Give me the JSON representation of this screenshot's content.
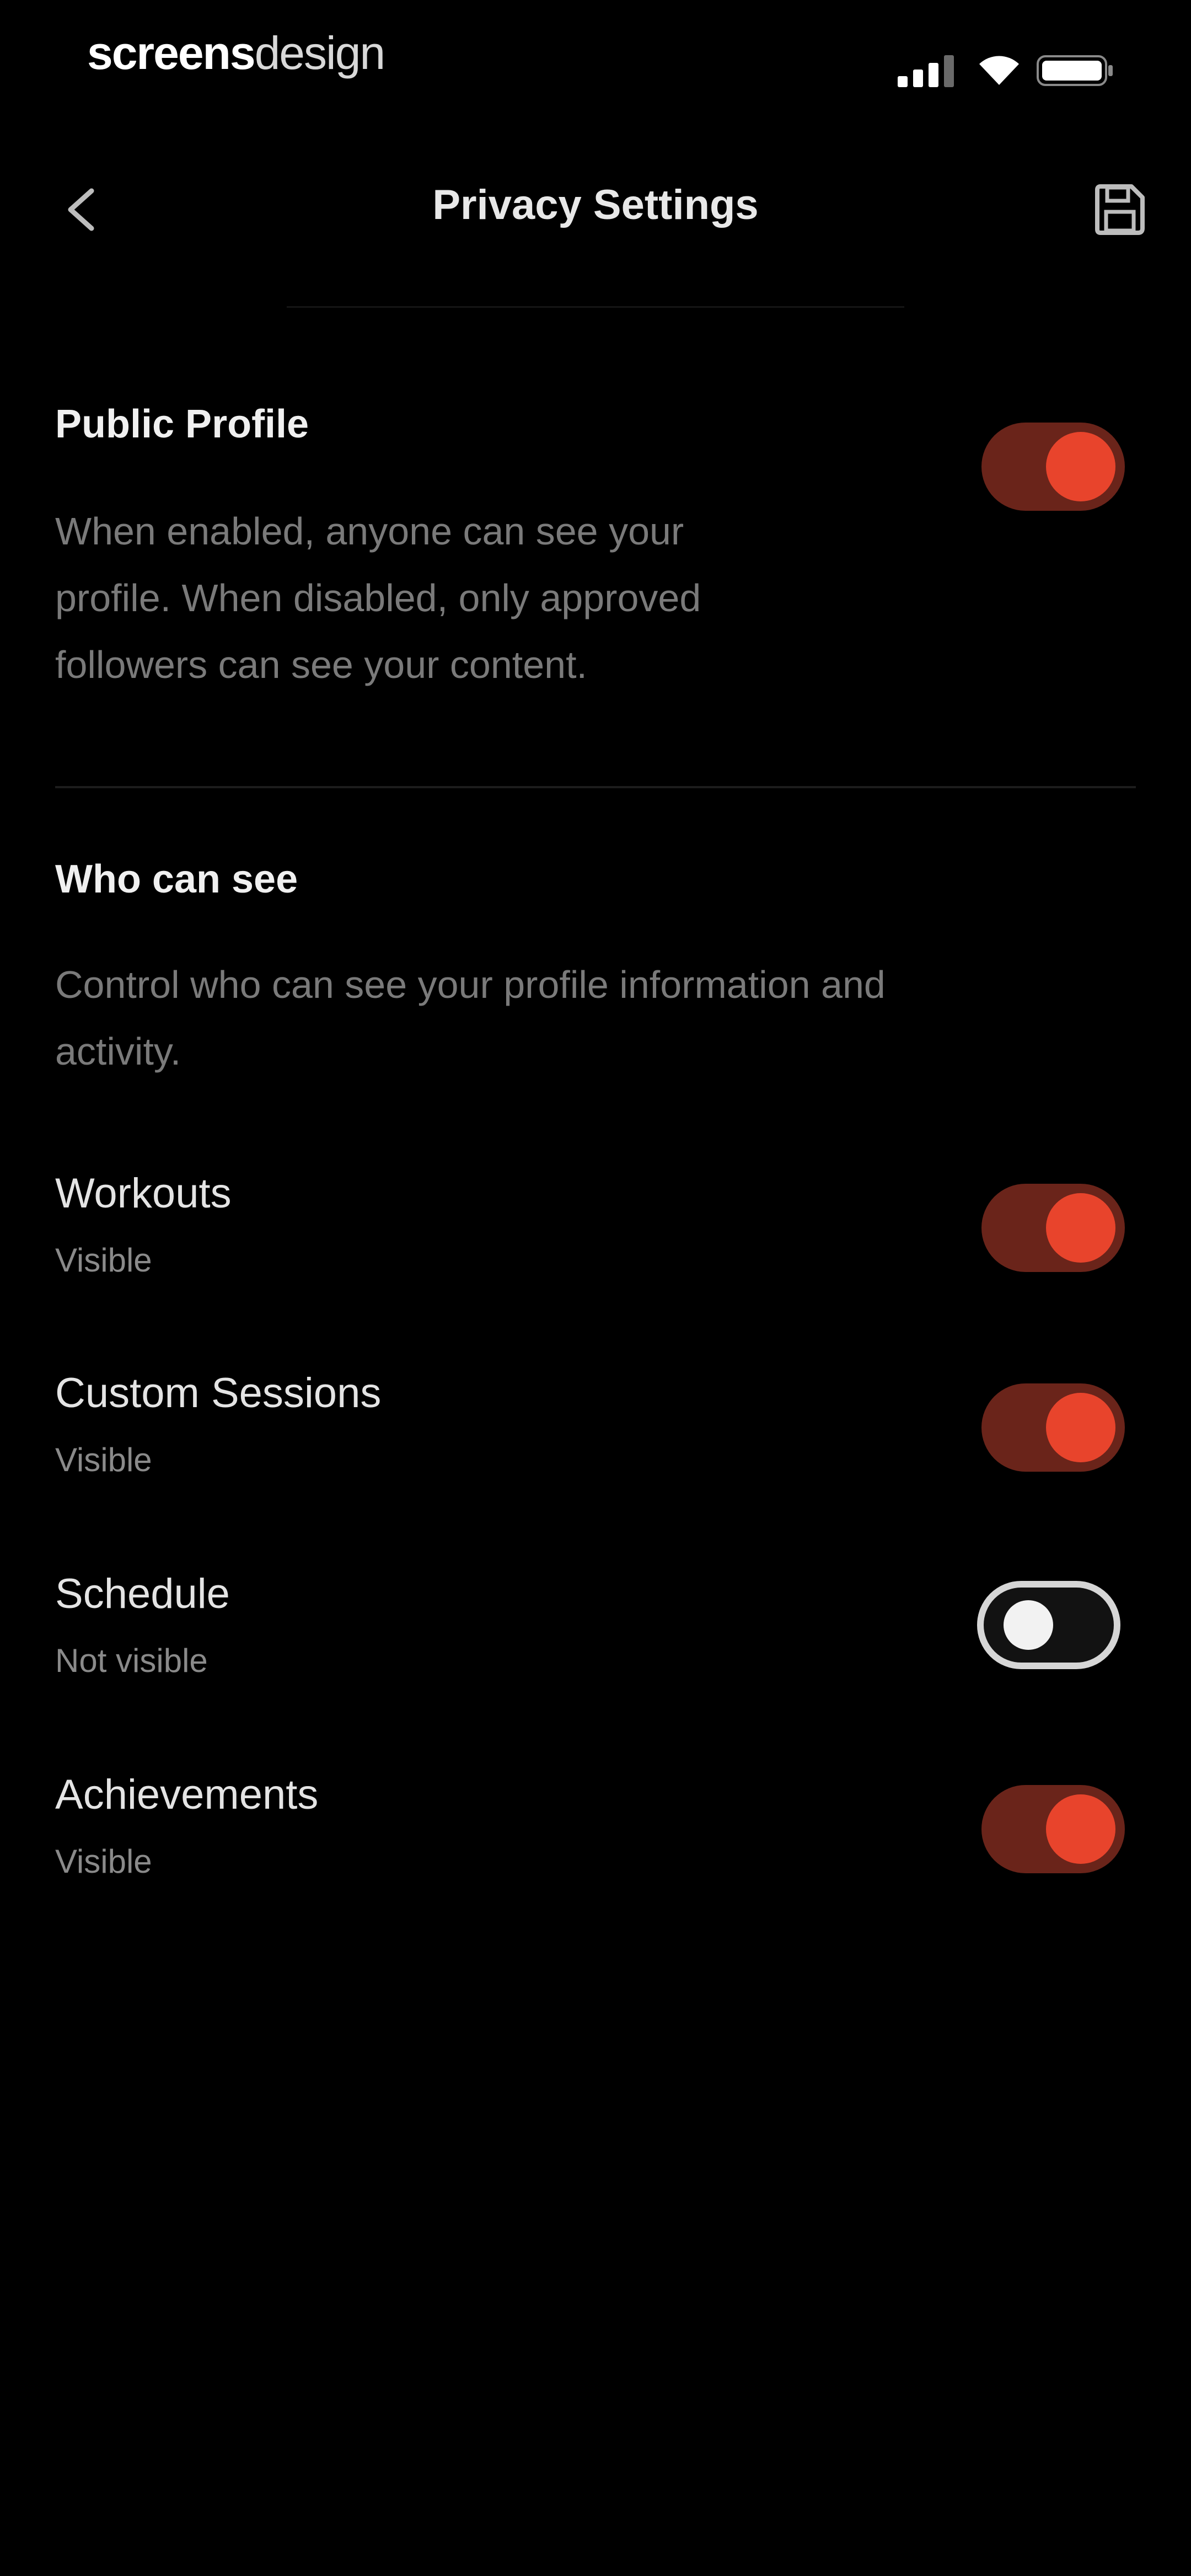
{
  "status_bar": {
    "brand_bold": "screens",
    "brand_light": "design"
  },
  "header": {
    "title": "Privacy Settings",
    "back_icon": "chevron-left-icon",
    "save_icon": "save-icon"
  },
  "public_profile": {
    "heading": "Public Profile",
    "description_lines": [
      "When enabled, anyone can see your",
      "profile. When disabled, only approved",
      "followers can see your content."
    ],
    "enabled": true
  },
  "who_can_see": {
    "heading": "Who can see",
    "description_lines": [
      "Control who can see your profile information and",
      "activity."
    ],
    "items": [
      {
        "label": "Workouts",
        "status": "Visible",
        "enabled": true
      },
      {
        "label": "Custom Sessions",
        "status": "Visible",
        "enabled": true
      },
      {
        "label": "Schedule",
        "status": "Not visible",
        "enabled": false
      },
      {
        "label": "Achievements",
        "status": "Visible",
        "enabled": true
      }
    ]
  },
  "colors": {
    "background": "#000000",
    "accent": "#e8442c",
    "accent_track": "#6a241a",
    "muted_text": "#7a7a7a"
  }
}
